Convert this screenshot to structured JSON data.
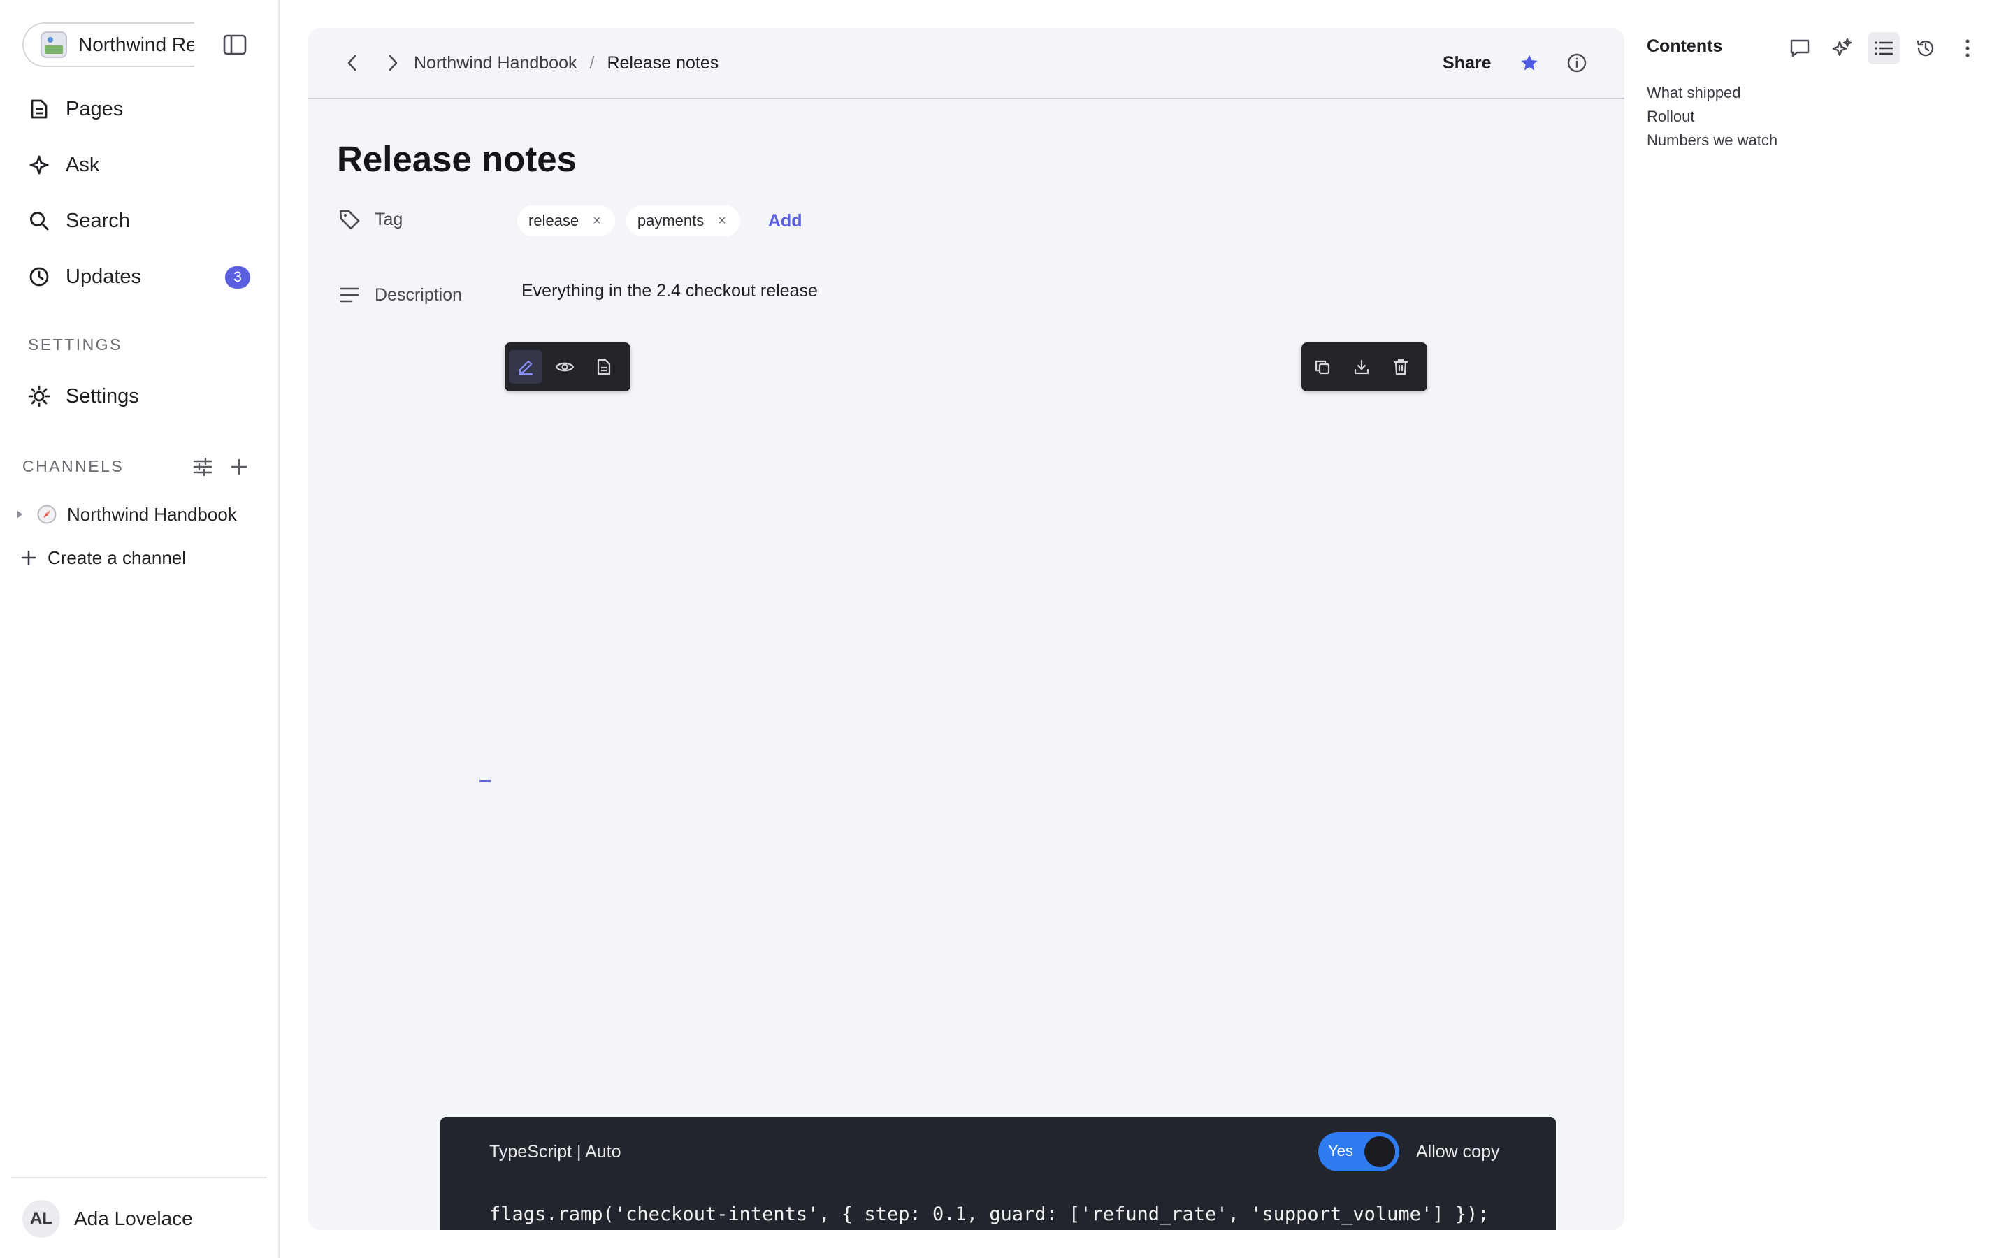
{
  "workspace": {
    "name": "Northwind Re"
  },
  "sidebar": {
    "nav": [
      {
        "label": "Pages",
        "icon": "page-icon"
      },
      {
        "label": "Ask",
        "icon": "sparkle-icon"
      },
      {
        "label": "Search",
        "icon": "search-icon"
      },
      {
        "label": "Updates",
        "icon": "clock-icon",
        "badge": "3"
      }
    ],
    "settings_section": "SETTINGS",
    "settings_item": {
      "label": "Settings",
      "icon": "sun-icon"
    },
    "channels_section": "CHANNELS",
    "channels": [
      {
        "label": "Northwind Handbook",
        "icon": "compass-icon"
      }
    ],
    "create_channel": "Create a channel",
    "user": {
      "initials": "AL",
      "name": "Ada Lovelace"
    }
  },
  "topbar": {
    "breadcrumb": [
      "Northwind Handbook",
      "Release notes"
    ],
    "breadcrumb_separator": "/",
    "share_label": "Share",
    "favorited": true
  },
  "document": {
    "title": "Release notes",
    "properties": {
      "tag_label": "Tag",
      "tags": [
        "release",
        "payments"
      ],
      "tag_remove_glyph": "×",
      "add_label": "Add",
      "description_label": "Description",
      "description_value": "Everything in the 2.4 checkout release"
    },
    "editor_toolbar": [
      "edit-icon",
      "preview-icon",
      "document-icon"
    ],
    "editor_toolbar_active": "edit-icon",
    "file_toolbar": [
      "copy-icon",
      "download-icon",
      "trash-icon"
    ]
  },
  "code_block": {
    "language": "TypeScript | Auto",
    "toggle_text": "Yes",
    "toggle_on": true,
    "toggle_label": "Allow copy",
    "code": "flags.ramp('checkout-intents', { step: 0.1, guard: ['refund_rate', 'support_volume'] });"
  },
  "contents": {
    "title": "Contents",
    "toolbar": [
      "comment-icon",
      "sparkles-icon",
      "list-icon",
      "history-icon",
      "more-vertical-icon"
    ],
    "items": [
      "What shipped",
      "Rollout",
      "Numbers we watch"
    ]
  },
  "colors": {
    "accent": "#5a5fe0",
    "toggle": "#2f7bf0",
    "code_bg": "#22252b",
    "panel_bg": "#f4f5f8"
  }
}
